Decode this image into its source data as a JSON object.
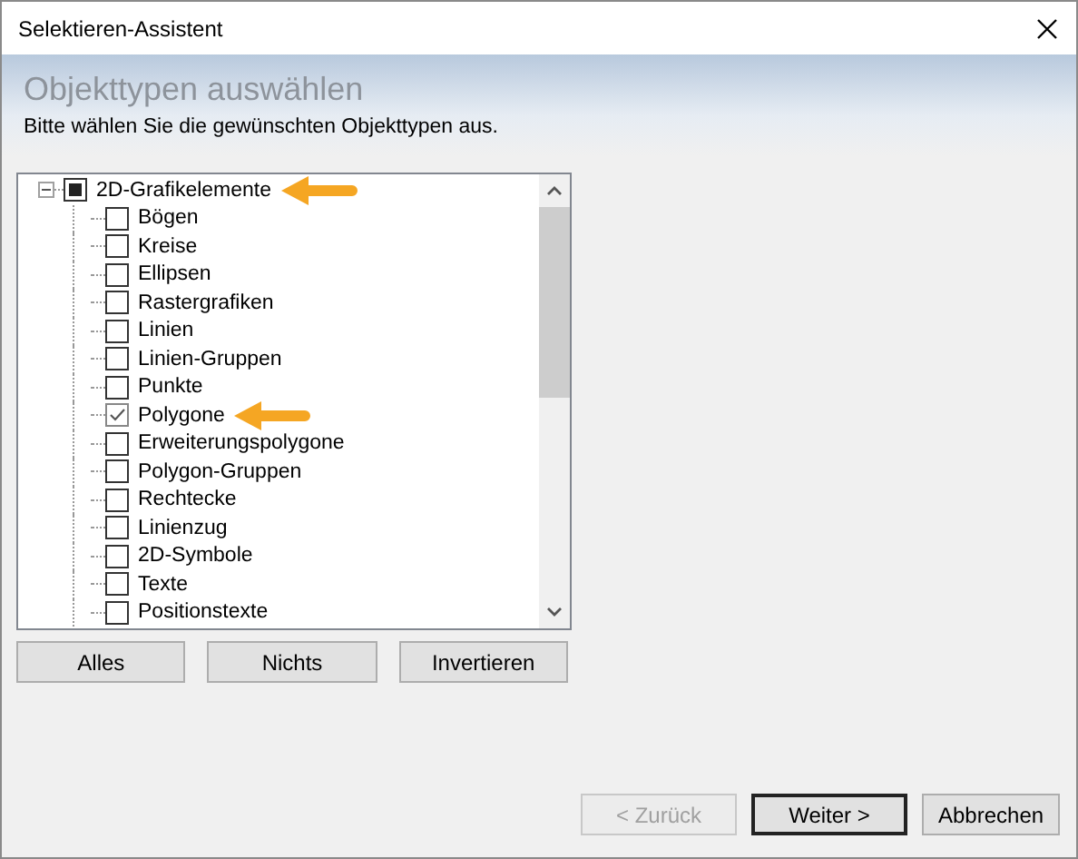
{
  "window": {
    "title": "Selektieren-Assistent"
  },
  "header": {
    "title": "Objekttypen auswählen",
    "subtitle": "Bitte wählen Sie die gewünschten Objekttypen aus."
  },
  "tree": [
    {
      "label": "2D-Grafikelemente",
      "checked": false,
      "indeterminate": true,
      "expanded": true,
      "marked": true,
      "children": [
        {
          "label": "Bögen",
          "checked": false,
          "marked": false
        },
        {
          "label": "Kreise",
          "checked": false,
          "marked": false
        },
        {
          "label": "Ellipsen",
          "checked": false,
          "marked": false
        },
        {
          "label": "Rastergrafiken",
          "checked": false,
          "marked": false
        },
        {
          "label": "Linien",
          "checked": false,
          "marked": false
        },
        {
          "label": "Linien-Gruppen",
          "checked": false,
          "marked": false
        },
        {
          "label": "Punkte",
          "checked": false,
          "marked": false
        },
        {
          "label": "Polygone",
          "checked": true,
          "marked": true
        },
        {
          "label": "Erweiterungspolygone",
          "checked": false,
          "marked": false
        },
        {
          "label": "Polygon-Gruppen",
          "checked": false,
          "marked": false
        },
        {
          "label": "Rechtecke",
          "checked": false,
          "marked": false
        },
        {
          "label": "Linienzug",
          "checked": false,
          "marked": false
        },
        {
          "label": "2D-Symbole",
          "checked": false,
          "marked": false
        },
        {
          "label": "Texte",
          "checked": false,
          "marked": false
        },
        {
          "label": "Positionstexte",
          "checked": false,
          "marked": false
        }
      ]
    }
  ],
  "tree_buttons": [
    "Alles",
    "Nichts",
    "Invertieren"
  ],
  "footer_buttons": [
    {
      "label": "< Zurück",
      "disabled": true,
      "default": false
    },
    {
      "label": "Weiter >",
      "disabled": false,
      "default": true
    },
    {
      "label": "Abbrechen",
      "disabled": false,
      "default": false
    }
  ]
}
